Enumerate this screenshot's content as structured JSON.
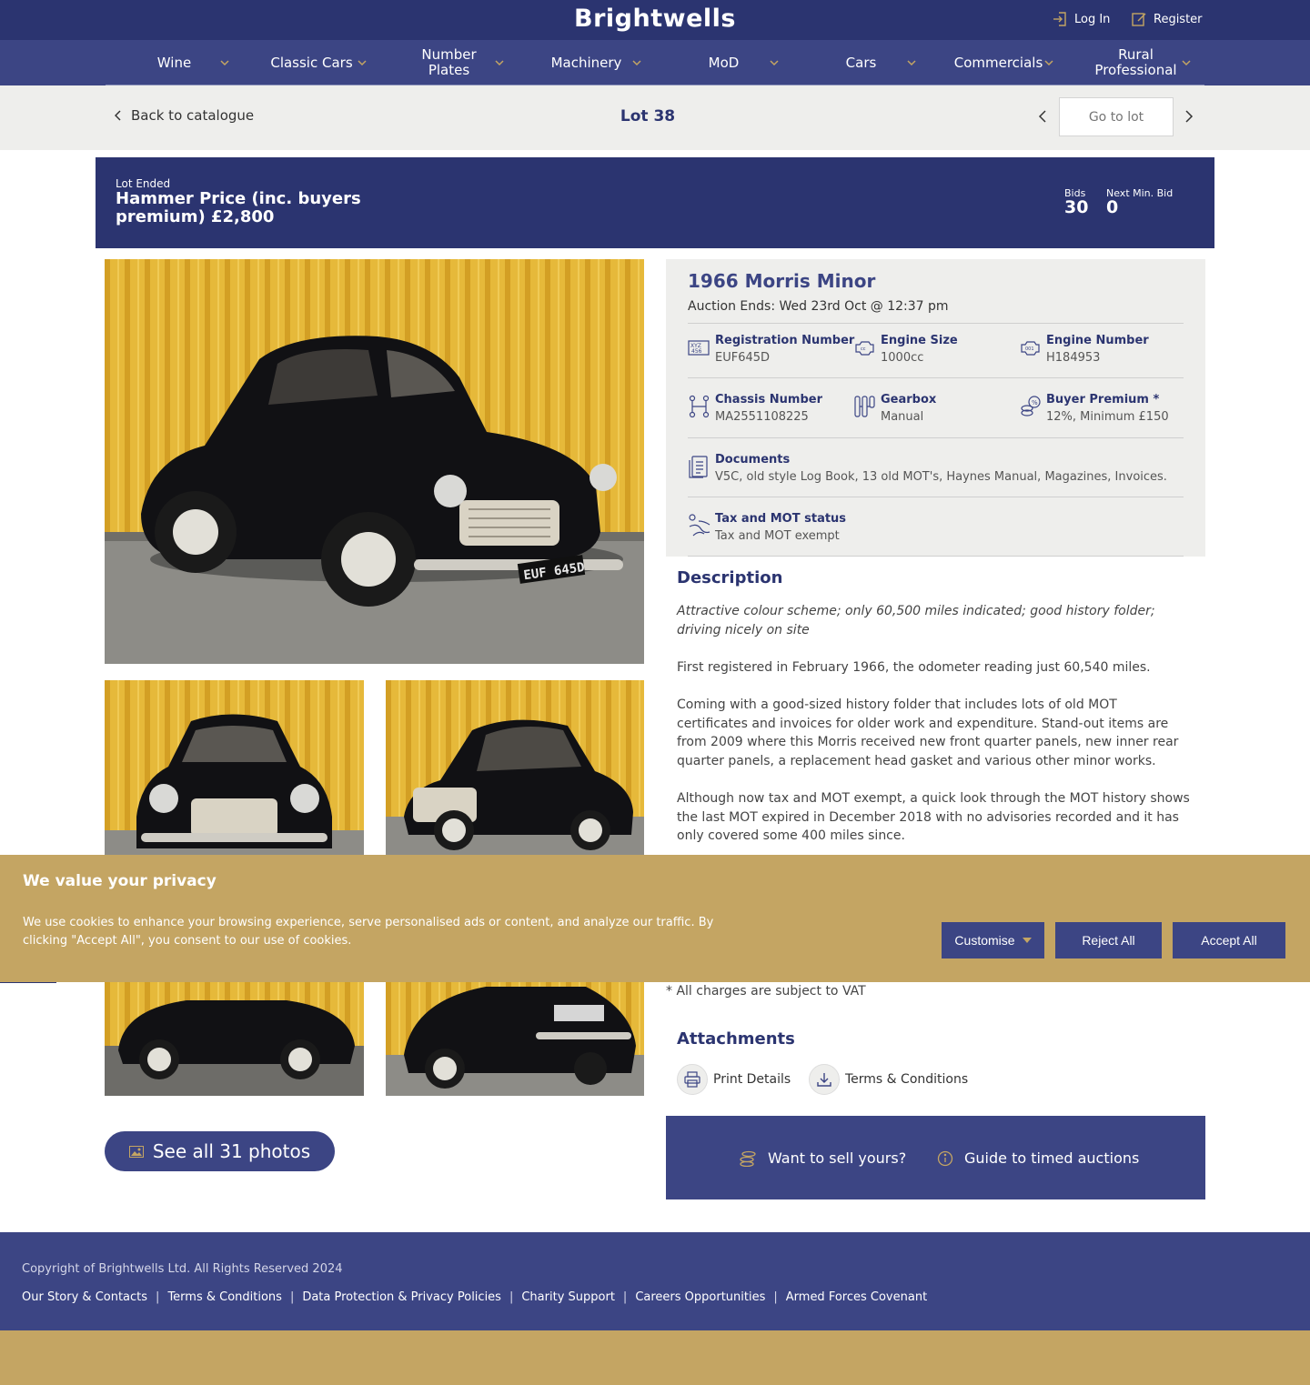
{
  "header": {
    "logo": "Brightwells",
    "login_label": "Log In",
    "register_label": "Register"
  },
  "nav": {
    "items": [
      {
        "label": "Wine"
      },
      {
        "label": "Classic Cars"
      },
      {
        "label": "Number Plates"
      },
      {
        "label": "Machinery"
      },
      {
        "label": "MoD"
      },
      {
        "label": "Cars"
      },
      {
        "label": "Commercials"
      },
      {
        "label": "Rural Professional"
      }
    ]
  },
  "lot_nav": {
    "back_label": "Back to catalogue",
    "lot_title": "Lot 38",
    "goto_placeholder": "Go to lot"
  },
  "status": {
    "lot_ended": "Lot Ended",
    "hammer_price": "Hammer Price (inc. buyers premium) £2,800",
    "bids_label": "Bids",
    "bids_value": "30",
    "next_min_bid_label": "Next Min. Bid",
    "next_min_bid_value": "0"
  },
  "vehicle": {
    "title": "1966 Morris Minor",
    "auction_ends": "Auction Ends: Wed 23rd Oct @ 12:37 pm",
    "plate_text": "EUF 645D",
    "specs": [
      {
        "key": "Registration Number",
        "value": "EUF645D",
        "icon": "registration-plate-icon"
      },
      {
        "key": "Engine Size",
        "value": "1000cc",
        "icon": "engine-size-icon"
      },
      {
        "key": "Engine Number",
        "value": "H184953",
        "icon": "engine-number-icon"
      },
      {
        "key": "Chassis Number",
        "value": "MA2551108225",
        "icon": "chassis-icon"
      },
      {
        "key": "Gearbox",
        "value": "Manual",
        "icon": "gearbox-icon"
      },
      {
        "key": "Buyer Premium *",
        "value": "12%, Minimum £150",
        "icon": "buyer-premium-icon"
      },
      {
        "key": "Documents",
        "value": "V5C, old style Log Book, 13 old MOT's, Haynes Manual, Magazines, Invoices.",
        "icon": "documents-icon"
      },
      {
        "key": "Tax and MOT status",
        "value": "Tax and MOT exempt",
        "icon": "road-icon"
      }
    ]
  },
  "description": {
    "heading": "Description",
    "paragraphs": [
      "Attractive colour scheme; only 60,500 miles indicated; good history folder; driving nicely on site",
      "First registered in February 1966, the odometer reading just 60,540 miles.",
      "Coming with a good-sized history folder that includes lots of old MOT certificates and invoices for older work and expenditure. Stand-out items are from 2009 where this Morris received new front quarter panels, new inner rear quarter panels, a replacement head gasket and various other minor works.",
      "Although now tax and MOT exempt, a quick look through the MOT history shows the last MOT expired in December 2018 with no advisories recorded and it has only covered some 400 miles since."
    ],
    "vat_note": "* All charges are subject to VAT"
  },
  "attachments": {
    "heading": "Attachments",
    "print_label": "Print Details",
    "terms_label": "Terms & Conditions"
  },
  "photos": {
    "see_all_label": "See all 31 photos"
  },
  "sell": {
    "want_to_sell": "Want to sell yours?",
    "guide": "Guide to timed auctions"
  },
  "cookie": {
    "title": "We value your privacy",
    "text": "We use cookies to enhance your browsing experience, serve personalised ads or content, and analyze our traffic. By clicking \"Accept All\", you consent to our use of cookies.",
    "customise": "Customise",
    "reject": "Reject All",
    "accept": "Accept All"
  },
  "footer": {
    "copyright": "Copyright of Brightwells Ltd. All Rights Reserved 2024",
    "links": [
      "Our Story & Contacts",
      "Terms & Conditions",
      "Data Protection & Privacy Policies",
      "Charity Support",
      "Careers Opportunities",
      "Armed Forces Covenant"
    ]
  },
  "colors": {
    "navy": "#2b3470",
    "nav_blue": "#3c4584",
    "gold": "#c4a563",
    "panel_grey": "#eeeeec"
  }
}
